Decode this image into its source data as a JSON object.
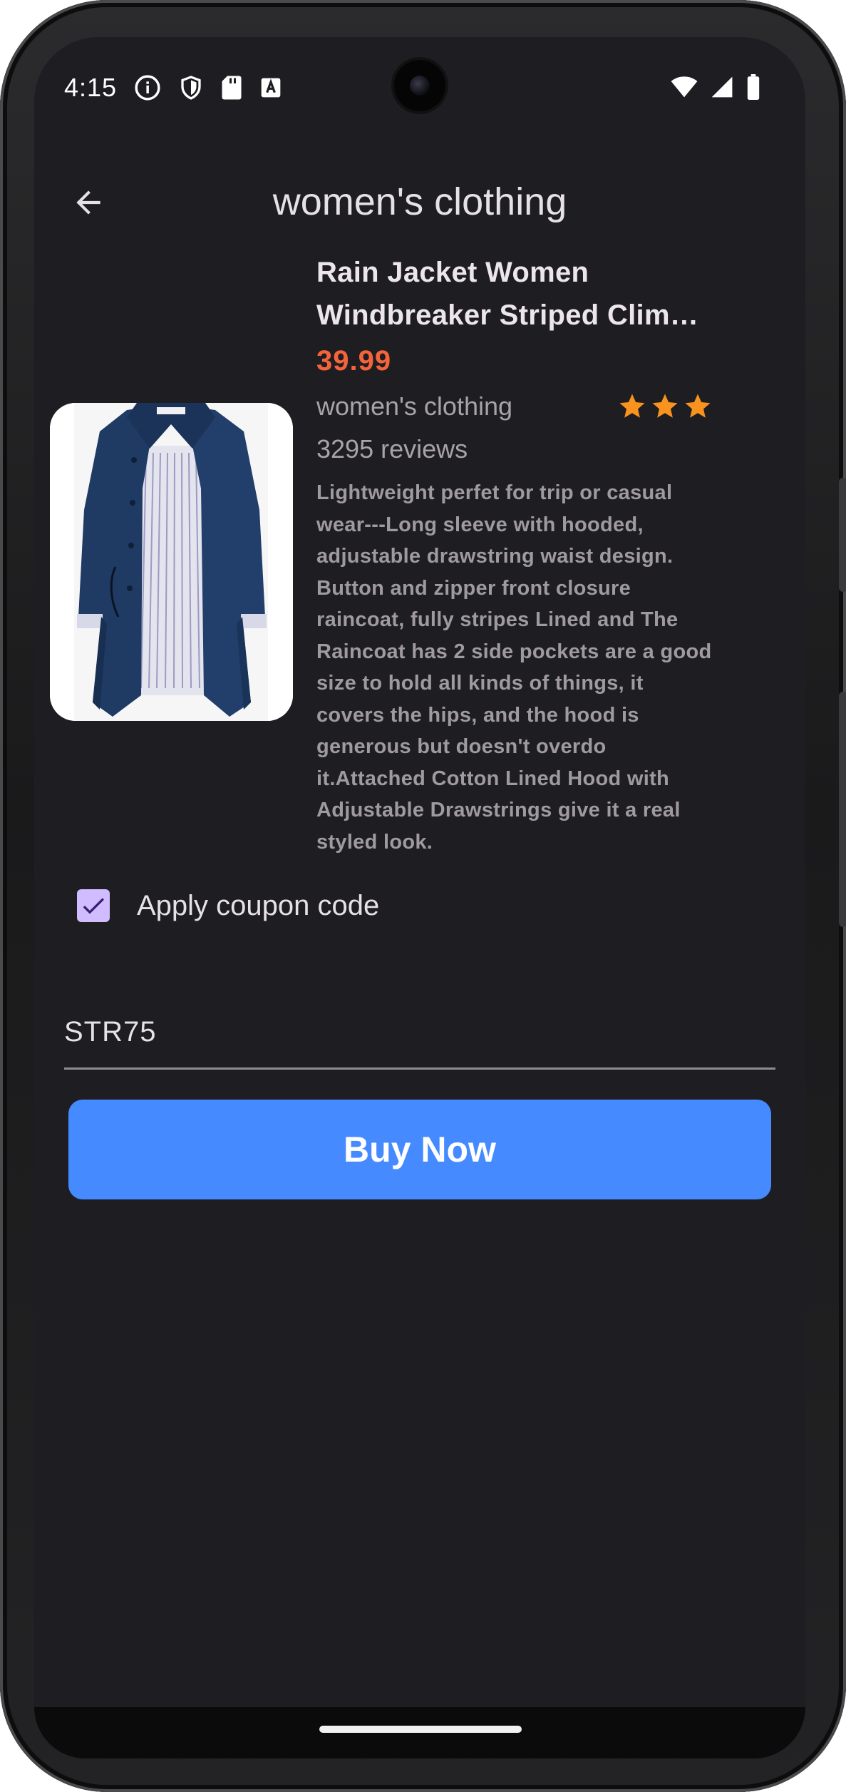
{
  "status_bar": {
    "time": "4:15",
    "left_icons": [
      "info-icon",
      "shield-icon",
      "sd-card-icon",
      "font-a-icon"
    ],
    "right_icons": [
      "wifi-icon",
      "signal-icon",
      "battery-icon"
    ]
  },
  "app_bar": {
    "title": "women's clothing",
    "back_icon": "arrow-back-icon"
  },
  "product": {
    "title_line1": "Rain Jacket Women",
    "title_line2": "Windbreaker Striped Clim…",
    "price": "39.99",
    "category": "women's clothing",
    "rating": 3,
    "reviews": "3295 reviews",
    "description": "Lightweight perfet for trip or casual wear---Long sleeve with hooded, adjustable drawstring waist design. Button and zipper front closure raincoat, fully stripes Lined and The Raincoat has 2 side pockets are a good size to hold all kinds of things, it covers the hips, and the hood is generous but doesn't overdo it.Attached Cotton Lined Hood with Adjustable Drawstrings give it a real styled look."
  },
  "coupon": {
    "checked": true,
    "label": "Apply coupon code",
    "value": "STR75"
  },
  "actions": {
    "buy_label": "Buy Now"
  },
  "colors": {
    "background": "#1e1d22",
    "price": "#f4643b",
    "star": "#f7931e",
    "button": "#458bff",
    "checkbox": "#d0bcff"
  }
}
